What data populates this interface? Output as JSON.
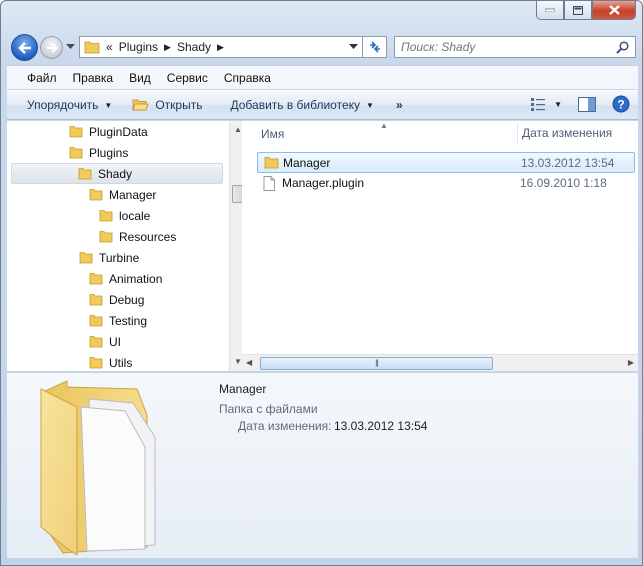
{
  "address": {
    "overflow": "«",
    "crumbs": [
      "Plugins",
      "Shady"
    ]
  },
  "search": {
    "placeholder": "Поиск: Shady"
  },
  "menu": [
    "Файл",
    "Правка",
    "Вид",
    "Сервис",
    "Справка"
  ],
  "toolbar": {
    "organize": "Упорядочить",
    "open": "Открыть",
    "add_library": "Добавить в библиотеку",
    "more": "»"
  },
  "tree": [
    {
      "label": "PluginData",
      "level": 0
    },
    {
      "label": "Plugins",
      "level": 0
    },
    {
      "label": "Shady",
      "level": 1,
      "selected": true
    },
    {
      "label": "Manager",
      "level": 2
    },
    {
      "label": "locale",
      "level": 3
    },
    {
      "label": "Resources",
      "level": 3
    },
    {
      "label": "Turbine",
      "level": 1
    },
    {
      "label": "Animation",
      "level": 2
    },
    {
      "label": "Debug",
      "level": 2
    },
    {
      "label": "Testing",
      "level": 2
    },
    {
      "label": "UI",
      "level": 2
    },
    {
      "label": "Utils",
      "level": 2
    }
  ],
  "columns": {
    "name": "Имя",
    "date": "Дата изменения"
  },
  "files": [
    {
      "name": "Manager",
      "date": "13.03.2012 13:54",
      "type": "folder",
      "selected": true
    },
    {
      "name": "Manager.plugin",
      "date": "16.09.2010 1:18",
      "type": "file"
    }
  ],
  "details": {
    "name": "Manager",
    "type": "Папка с файлами",
    "date_label": "Дата изменения:",
    "date_value": "13.03.2012 13:54"
  },
  "colors": {
    "selection": "#d9ebfc",
    "selection_border": "#8cbcef",
    "folder": "#f2d064",
    "close_button": "#c4412b"
  }
}
